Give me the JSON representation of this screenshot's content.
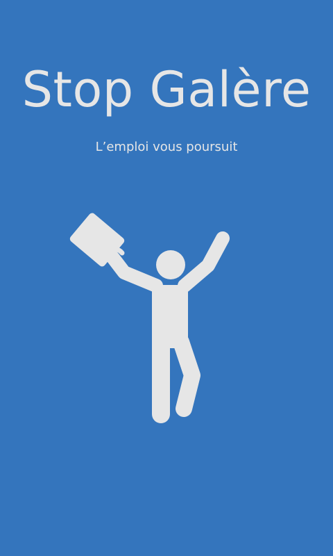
{
  "splash": {
    "title": "Stop Galère",
    "tagline": "L’emploi vous poursuit",
    "illustration_icon": "person-celebrating-with-briefcase-icon"
  },
  "colors": {
    "background": "#3475BD",
    "foreground": "#E6E6E6"
  }
}
